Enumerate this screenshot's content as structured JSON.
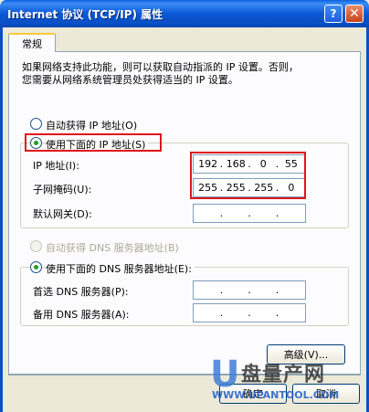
{
  "window": {
    "title": "Internet 协议 (TCP/IP) 属性",
    "help_label": "?",
    "close_label": "✕"
  },
  "tab": {
    "label": "常规"
  },
  "intro": {
    "line1": "如果网络支持此功能，则可以获取自动指派的 IP 设置。否则，",
    "line2": "您需要从网络系统管理员处获得适当的 IP 设置。"
  },
  "ip_mode": {
    "auto_label": "自动获得 IP 地址(O)",
    "manual_label": "使用下面的 IP 地址(S)",
    "selected": "manual"
  },
  "ip_fields": [
    {
      "label": "IP 地址(I):",
      "octets": [
        "192",
        "168",
        "0",
        "55"
      ]
    },
    {
      "label": "子网掩码(U):",
      "octets": [
        "255",
        "255",
        "255",
        "0"
      ]
    },
    {
      "label": "默认网关(D):",
      "octets": [
        "",
        "",
        "",
        ""
      ]
    }
  ],
  "dns_mode": {
    "auto_label": "自动获得 DNS 服务器地址(B)",
    "manual_label": "使用下面的 DNS 服务器地址(E):",
    "selected": "manual",
    "auto_disabled": true
  },
  "dns_fields": [
    {
      "label": "首选 DNS 服务器(P):",
      "octets": [
        "",
        "",
        "",
        ""
      ]
    },
    {
      "label": "备用 DNS 服务器(A):",
      "octets": [
        "",
        "",
        "",
        ""
      ]
    }
  ],
  "buttons": {
    "advanced": "高级(V)...",
    "ok": "确定",
    "cancel": "取消"
  },
  "watermark": {
    "letter": "U",
    "brand": "盘量产网",
    "url": "WWW.UPANTOOL.COM"
  },
  "colors": {
    "highlight": "#e0161a",
    "titlebar": "#0a4fc4",
    "dialog_bg": "#ece9d8"
  }
}
